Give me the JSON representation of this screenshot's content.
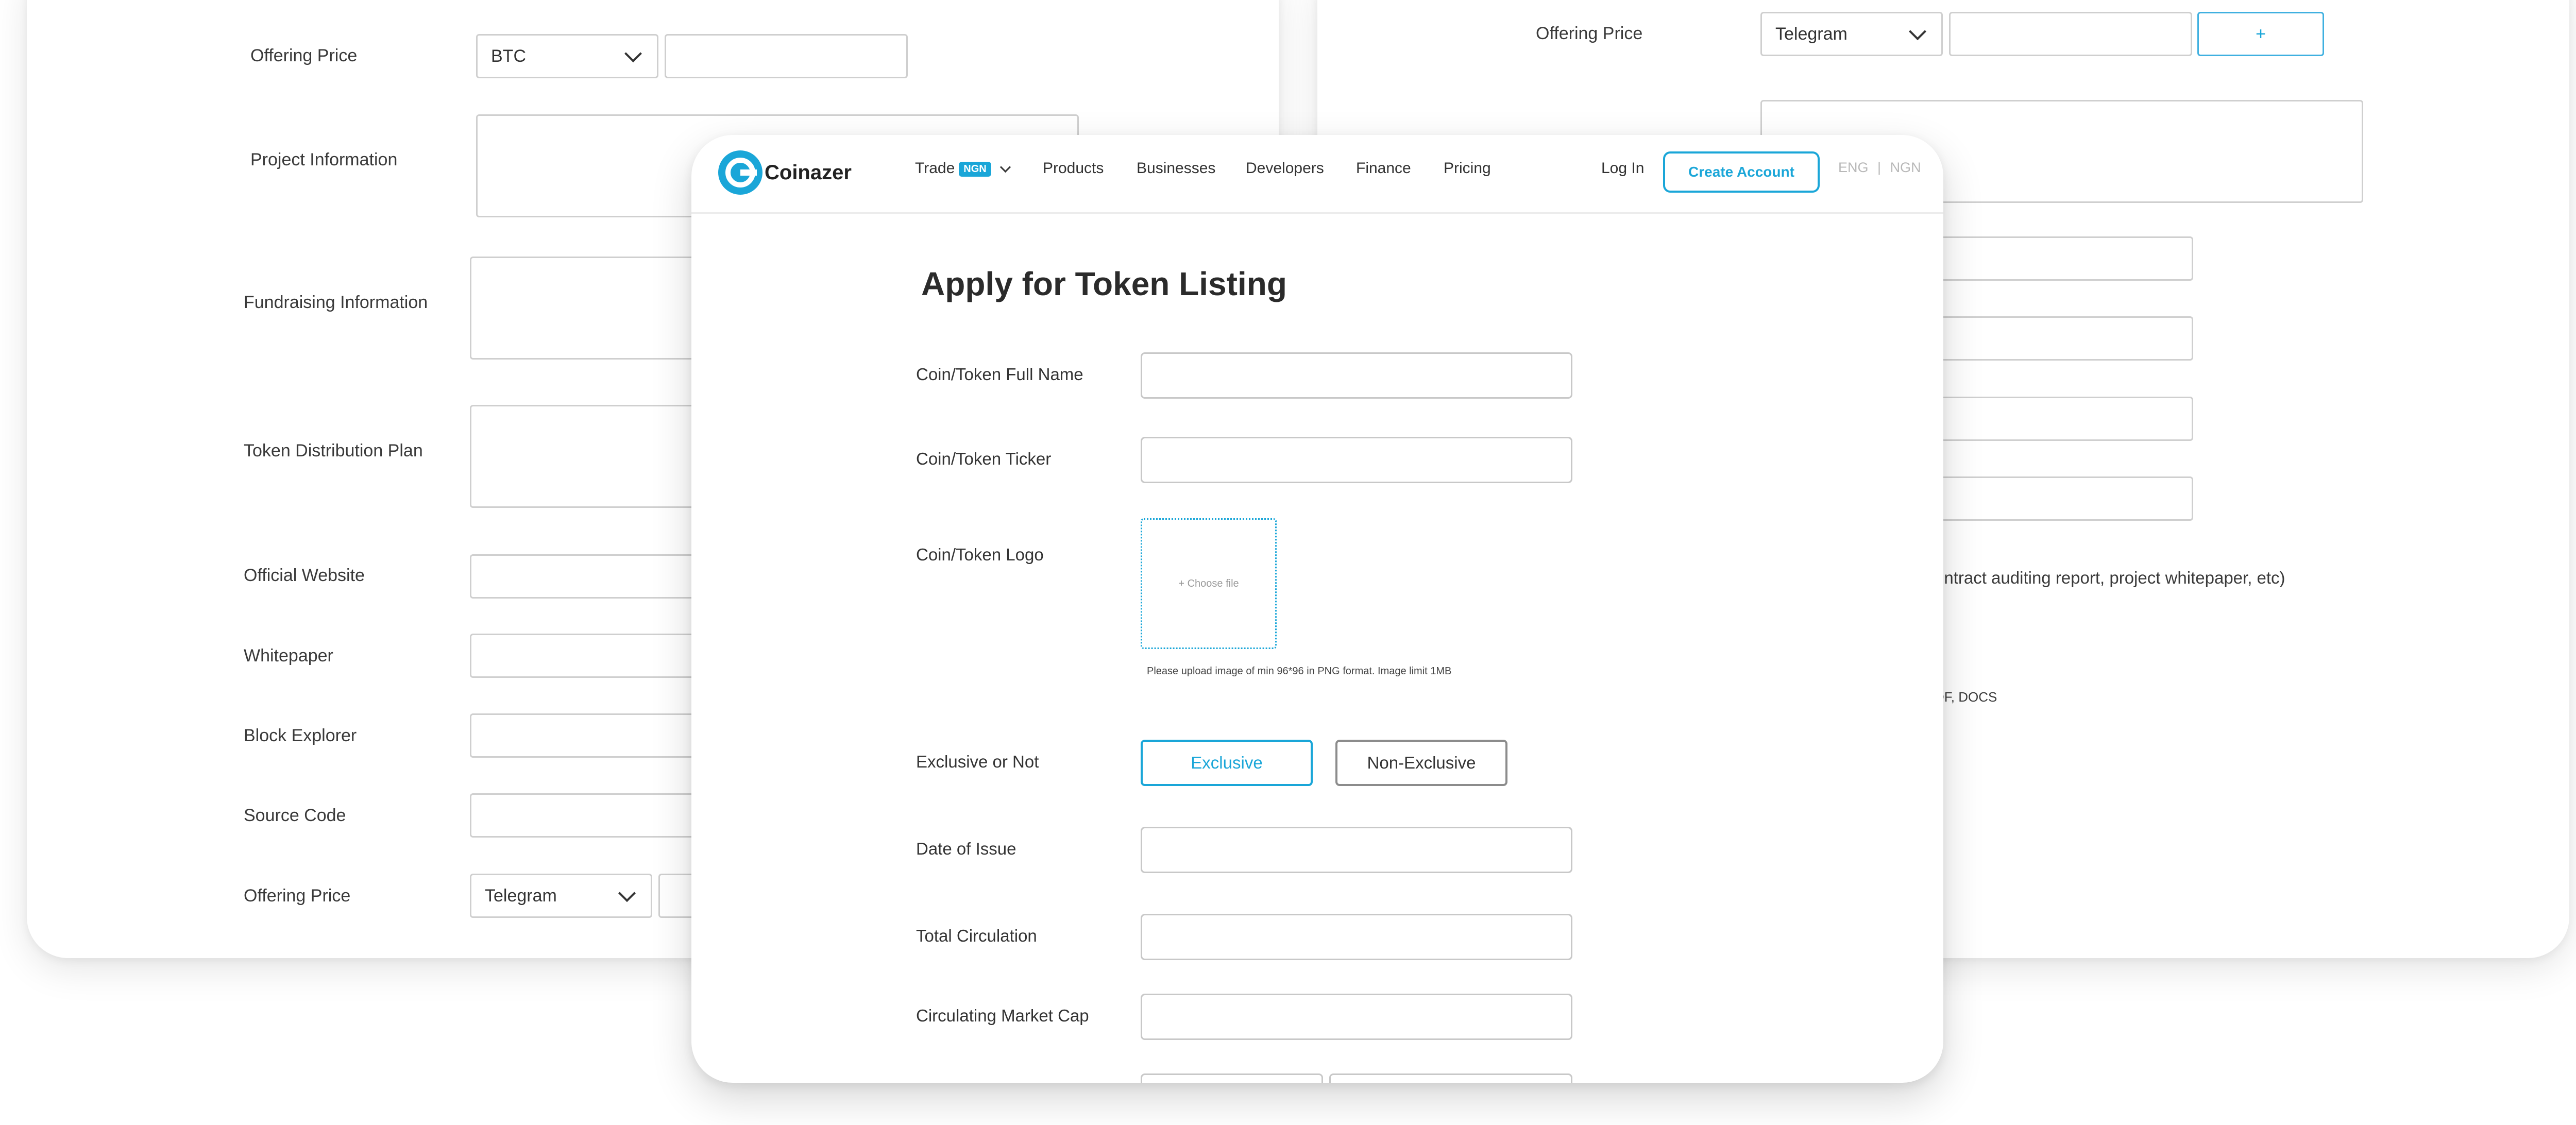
{
  "left_card": {
    "offering_price_top_label": "Offering Price",
    "currency_select_value": "BTC",
    "project_information_label": "Project Information",
    "fundraising_information_label": "Fundraising Information",
    "token_distribution_plan_label": "Token Distribution Plan",
    "official_website_label": "Official Website",
    "whitepaper_label": "Whitepaper",
    "block_explorer_label": "Block Explorer",
    "source_code_label": "Source Code",
    "offering_price_bottom_label": "Offering Price",
    "social_select_value": "Telegram"
  },
  "right_card": {
    "offering_price_label": "Offering Price",
    "social_select_value": "Telegram",
    "add_button_label": "+",
    "documents_text": "ontract auditing report, project whitepaper, etc)",
    "formats_text": "DF, DOCS"
  },
  "header": {
    "logo_text": "Coinazer",
    "nav": {
      "trade": "Trade",
      "trade_badge": "NGN",
      "products": "Products",
      "businesses": "Businesses",
      "developers": "Developers",
      "finance": "Finance",
      "pricing": "Pricing"
    },
    "login": "Log In",
    "create_account": "Create Account",
    "lang": "ENG",
    "separator": "|",
    "currency": "NGN"
  },
  "form": {
    "title": "Apply for Token Listing",
    "full_name_label": "Coin/Token Full Name",
    "ticker_label": "Coin/Token Ticker",
    "logo_label": "Coin/Token Logo",
    "choose_file": "+ Choose file",
    "upload_hint": "Please upload image of min 96*96 in PNG format. Image limit 1MB",
    "exclusive_label": "Exclusive or Not",
    "exclusive_option": "Exclusive",
    "non_exclusive_option": "Non-Exclusive",
    "date_label": "Date of Issue",
    "total_circulation_label": "Total Circulation",
    "market_cap_label": "Circulating Market Cap"
  },
  "colors": {
    "accent": "#1aa6d8",
    "border": "#c8c8c8",
    "text": "#333333"
  }
}
